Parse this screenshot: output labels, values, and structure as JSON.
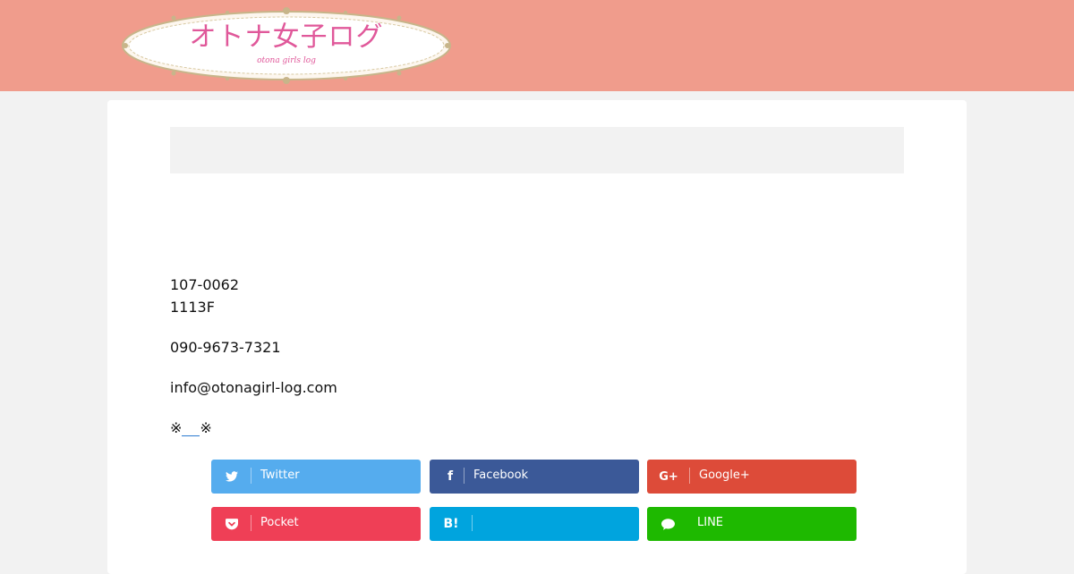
{
  "header": {
    "logo_title": "オトナ女子ログ",
    "logo_subtitle": "otona girls log"
  },
  "contact": {
    "postal": "107-0062",
    "address": "1113F",
    "phone": "090-9673-7321",
    "email": "info@otonagirl-log.com",
    "note_prefix": "※",
    "note_suffix": "※"
  },
  "share": {
    "twitter": "Twitter",
    "facebook": "Facebook",
    "googleplus": "Google+",
    "pocket": "Pocket",
    "hatena": "",
    "hatena_icon": "B!",
    "line": "LINE"
  },
  "colors": {
    "header": "#f09c8c",
    "twitter": "#55acee",
    "facebook": "#3b5998",
    "googleplus": "#dd4b39",
    "pocket": "#ef3f56",
    "hatena": "#00a4de",
    "line": "#1eb900"
  }
}
